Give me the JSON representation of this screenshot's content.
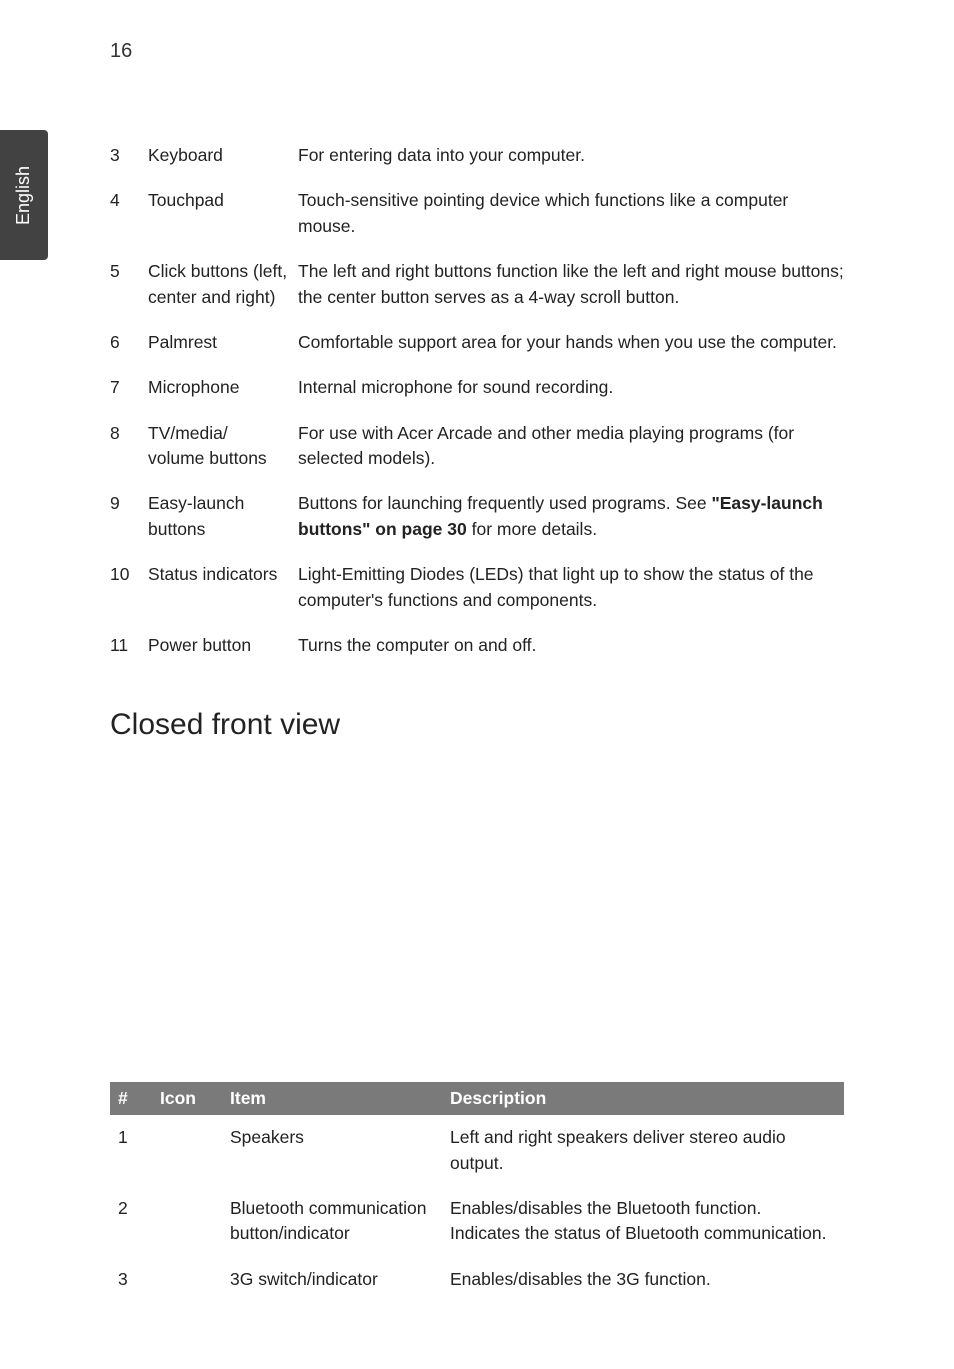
{
  "page_number": "16",
  "side_tab": "English",
  "rows": [
    {
      "num": "3",
      "item": "Keyboard",
      "desc": "For entering data into your computer."
    },
    {
      "num": "4",
      "item": "Touchpad",
      "desc": "Touch-sensitive pointing device which functions like a computer mouse."
    },
    {
      "num": "5",
      "item": "Click buttons (left, center and right)",
      "desc": "The left and right buttons function like the left and right mouse buttons; the center button serves as a 4-way scroll button."
    },
    {
      "num": "6",
      "item": "Palmrest",
      "desc": "Comfortable support area for your hands when you use the computer."
    },
    {
      "num": "7",
      "item": "Microphone",
      "desc": "Internal microphone for sound recording."
    },
    {
      "num": "8",
      "item": "TV/media/ volume buttons",
      "desc": "For use with Acer Arcade and other media playing programs (for selected models)."
    },
    {
      "num": "9",
      "item": "Easy-launch buttons",
      "desc_pre": "Buttons for launching frequently used programs. See ",
      "desc_bold": "\"Easy-launch buttons\" on page 30",
      "desc_post": " for more details."
    },
    {
      "num": "10",
      "item": "Status indicators",
      "desc": "Light-Emitting Diodes (LEDs) that light up to show the status of the computer's functions and components."
    },
    {
      "num": "11",
      "item": "Power button",
      "desc": "Turns the computer on and off."
    }
  ],
  "heading": "Closed front view",
  "table": {
    "headers": {
      "hash": "#",
      "icon": "Icon",
      "item": "Item",
      "description": "Description"
    },
    "rows": [
      {
        "num": "1",
        "icon": "",
        "item": "Speakers",
        "desc": "Left and right speakers deliver stereo audio output."
      },
      {
        "num": "2",
        "icon": "",
        "item": "Bluetooth communication button/indicator",
        "desc": "Enables/disables the Bluetooth function. Indicates the status of Bluetooth communication."
      },
      {
        "num": "3",
        "icon": "",
        "item": "3G switch/indicator",
        "desc": "Enables/disables the 3G function."
      }
    ]
  }
}
